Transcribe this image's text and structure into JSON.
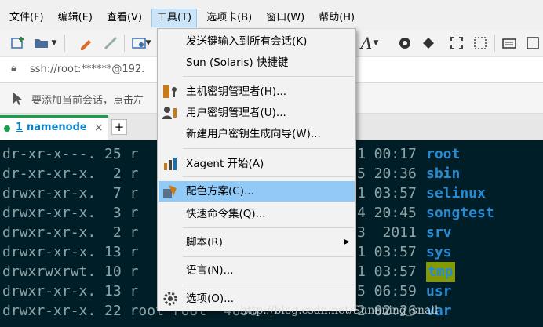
{
  "menubar": {
    "items": [
      {
        "label": "文件(F)"
      },
      {
        "label": "编辑(E)"
      },
      {
        "label": "查看(V)"
      },
      {
        "label": "工具(T)"
      },
      {
        "label": "选项卡(B)"
      },
      {
        "label": "窗口(W)"
      },
      {
        "label": "帮助(H)"
      }
    ],
    "active_index": 3
  },
  "toolbar": {
    "icons": [
      "new-session-icon",
      "open-folder-icon",
      "dropdown-icon",
      "edit-icon",
      "disconnect-icon",
      "settings-icon",
      "dropdown-icon",
      "font-icon",
      "dropdown-icon",
      "xagent-icon",
      "xftp-icon",
      "fullscreen-icon",
      "transparent-icon",
      "keyboard-icon",
      "more-icon"
    ],
    "font_glyph": "A"
  },
  "address": {
    "text": "ssh://root:******@192."
  },
  "hint": {
    "text": "要添加当前会话，点击左"
  },
  "tabs": {
    "items": [
      {
        "number": "1",
        "label": "namenode"
      }
    ],
    "close_glyph": "×",
    "add_glyph": "+"
  },
  "terminal": {
    "lines": [
      {
        "perm": "dr-xr-x---.",
        "links": "25",
        "owner_frag": "r",
        "time_frag": "1 00:17",
        "name": "root"
      },
      {
        "perm": "dr-xr-xr-x.",
        "links": "2",
        "owner_frag": "r",
        "time_frag": "5 20:36",
        "name": "sbin"
      },
      {
        "perm": "drwxr-xr-x.",
        "links": "7",
        "owner_frag": "r",
        "time_frag": "1 03:57",
        "name": "selinux"
      },
      {
        "perm": "drwxr-xr-x.",
        "links": "3",
        "owner_frag": "r",
        "time_frag": "4 20:45",
        "name": "songtest"
      },
      {
        "perm": "drwxr-xr-x.",
        "links": "2",
        "owner_frag": "r",
        "time_frag": "3  2011",
        "name": "srv"
      },
      {
        "perm": "drwxr-xr-x.",
        "links": "13",
        "owner_frag": "r",
        "time_frag": "1 03:57",
        "name": "sys"
      },
      {
        "perm": "drwxrwxrwt.",
        "links": "10",
        "owner_frag": "r",
        "time_frag": "1 03:57",
        "name": "tmp"
      },
      {
        "perm": "drwxr-xr-x.",
        "links": "13",
        "owner_frag": "r",
        "time_frag": "5 06:59",
        "name": "usr"
      },
      {
        "perm": "drwxr-xr-x.",
        "links": "22",
        "owner_frag": "root root  4096",
        "time_frag": "2 02:26",
        "name": "var"
      }
    ]
  },
  "tools_menu": {
    "items": [
      {
        "label": "发送键输入到所有会话(K)",
        "icon": ""
      },
      {
        "label": "Sun (Solaris) 快捷键",
        "icon": ""
      },
      {
        "label": "主机密钥管理者(H)...",
        "icon": "host-key-icon"
      },
      {
        "label": "用户密钥管理者(U)...",
        "icon": "user-key-icon"
      },
      {
        "label": "新建用户密钥生成向导(W)...",
        "icon": ""
      },
      {
        "label": "Xagent 开始(A)",
        "icon": "xagent-icon"
      },
      {
        "label": "配色方案(C)...",
        "icon": "color-scheme-icon"
      },
      {
        "label": "快速命令集(Q)...",
        "icon": ""
      },
      {
        "label": "脚本(R)",
        "icon": "",
        "submenu_glyph": "▶"
      },
      {
        "label": "语言(N)...",
        "icon": ""
      },
      {
        "label": "选项(O)...",
        "icon": "gear-icon"
      }
    ],
    "highlighted_index": 6
  },
  "watermark": {
    "text": "http://blog.csdn.net/Sunnning_snail"
  },
  "colors": {
    "terminal_bg": "#001e27",
    "terminal_fg": "#8fa4a8",
    "filename": "#268bd2",
    "tmp_bg": "#859900",
    "tab_accent": "#1a9e4b",
    "menu_highlight": "#91c9f7"
  }
}
